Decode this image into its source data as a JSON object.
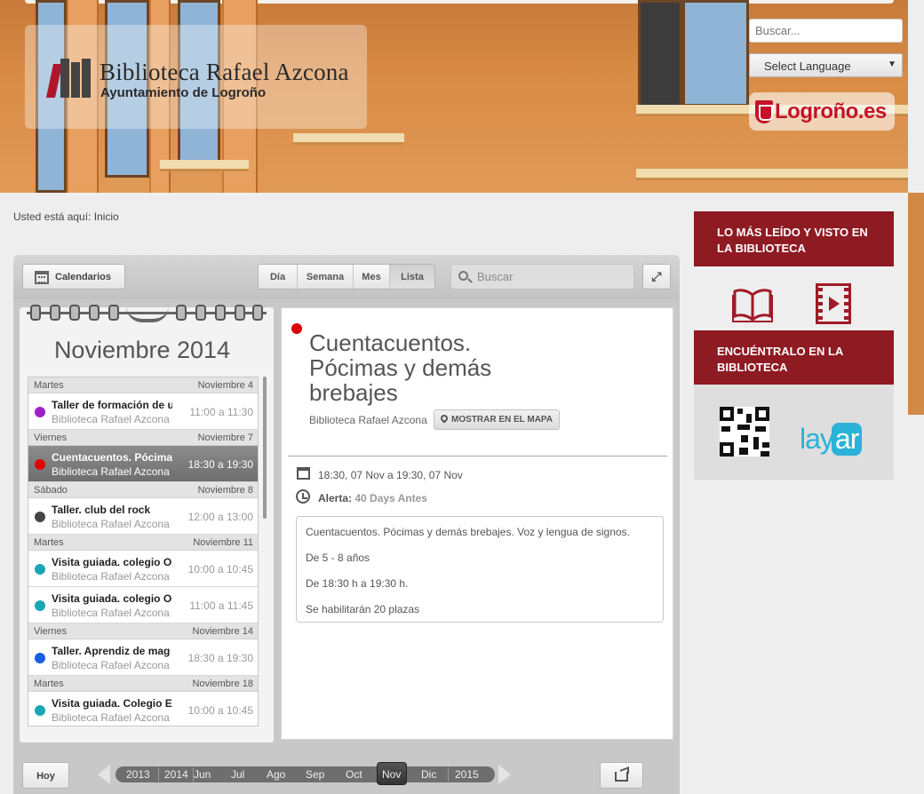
{
  "header": {
    "logo_title": "Biblioteca Rafael Azcona",
    "logo_subtitle": "Ayuntamiento de Logroño",
    "search_placeholder": "Buscar...",
    "language_select": "Select Language",
    "city_logo": "Logroño.es"
  },
  "breadcrumb": "Usted está aquí: Inicio",
  "calendar": {
    "calendars_button": "Calendarios",
    "views": [
      "Día",
      "Semana",
      "Mes",
      "Lista"
    ],
    "active_view": "Lista",
    "search_placeholder": "Buscar",
    "month_title": "Noviembre 2014",
    "days": [
      {
        "weekday": "Martes",
        "date": "Noviembre 4",
        "events": [
          {
            "title": "Taller de formación de u",
            "place": "Biblioteca Rafael Azcona",
            "time": "11:00 a 11:30",
            "color": "#a020c8",
            "selected": false
          }
        ]
      },
      {
        "weekday": "Viernes",
        "date": "Noviembre 7",
        "events": [
          {
            "title": "Cuentacuentos. Pócima",
            "place": "Biblioteca Rafael Azcona",
            "time": "18:30 a 19:30",
            "color": "#e00000",
            "selected": true
          }
        ]
      },
      {
        "weekday": "Sábado",
        "date": "Noviembre 8",
        "events": [
          {
            "title": "Taller. club del rock",
            "place": "Biblioteca Rafael Azcona",
            "time": "12:00 a 13:00",
            "color": "#444444",
            "selected": false
          }
        ]
      },
      {
        "weekday": "Martes",
        "date": "Noviembre 11",
        "events": [
          {
            "title": "Visita guiada. colegio Ol",
            "place": "Biblioteca Rafael Azcona",
            "time": "10:00 a 10:45",
            "color": "#1aa6b6",
            "selected": false
          },
          {
            "title": "Visita guiada. colegio Ol",
            "place": "Biblioteca Rafael Azcona",
            "time": "11:00 a 11:45",
            "color": "#1aa6b6",
            "selected": false
          }
        ]
      },
      {
        "weekday": "Viernes",
        "date": "Noviembre 14",
        "events": [
          {
            "title": "Taller. Aprendiz de mag",
            "place": "Biblioteca Rafael Azcona",
            "time": "18:30 a 19:30",
            "color": "#1a5ee0",
            "selected": false
          }
        ]
      },
      {
        "weekday": "Martes",
        "date": "Noviembre 18",
        "events": [
          {
            "title": "Visita guiada. Colegio E:",
            "place": "Biblioteca Rafael Azcona",
            "time": "10:00 a 10:45",
            "color": "#1aa6b6",
            "selected": false
          }
        ]
      }
    ],
    "detail": {
      "title": "Cuentacuentos. Pócimas y demás brebajes",
      "place": "Biblioteca Rafael Azcona",
      "map_button": "MOSTRAR EN EL MAPA",
      "when": "18:30, 07 Nov a 19:30, 07 Nov",
      "alert_label": "Alerta:",
      "alert_value": "40 Days Antes",
      "description": [
        "Cuentacuentos. Pócimas y demás brebajes. Voz y lengua de signos.",
        "De 5 - 8 años",
        "De 18:30 h a 19:30 h.",
        "Se habilitarán 20 plazas"
      ],
      "dot_color": "#e00000"
    },
    "today_button": "Hoy",
    "timeline": [
      "2013",
      "2014",
      "Jun",
      "Jul",
      "Ago",
      "Sep",
      "Oct",
      "Nov",
      "Dic",
      "2015"
    ],
    "timeline_active": "Nov"
  },
  "sidebar": {
    "most_read_heading": "LO MÁS LEÍDO Y VISTO EN LA BIBLIOTECA",
    "find_heading": "ENCUÉNTRALO EN LA BIBLIOTECA",
    "layar_logo": "layar",
    "accent_color": "#8e1a22"
  }
}
